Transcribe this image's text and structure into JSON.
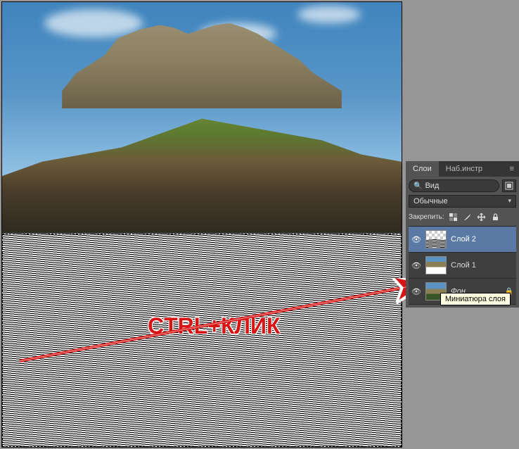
{
  "annotation_text": "CTRL+КЛИК",
  "panel": {
    "tabs": {
      "layers": "Слои",
      "presets": "Наб.инстр"
    },
    "search": {
      "placeholder": "Вид"
    },
    "blend_mode": "Обычные",
    "lock_label": "Закрепить:",
    "tooltip": "Миниатюра слоя",
    "layers": [
      {
        "name": "Слой 2",
        "selected": true,
        "visible": true,
        "thumb": "noise",
        "locked": false,
        "italic": false
      },
      {
        "name": "Слой 1",
        "selected": false,
        "visible": true,
        "thumb": "castle",
        "locked": false,
        "italic": false
      },
      {
        "name": "Фон",
        "selected": false,
        "visible": true,
        "thumb": "full",
        "locked": true,
        "italic": true
      }
    ]
  }
}
